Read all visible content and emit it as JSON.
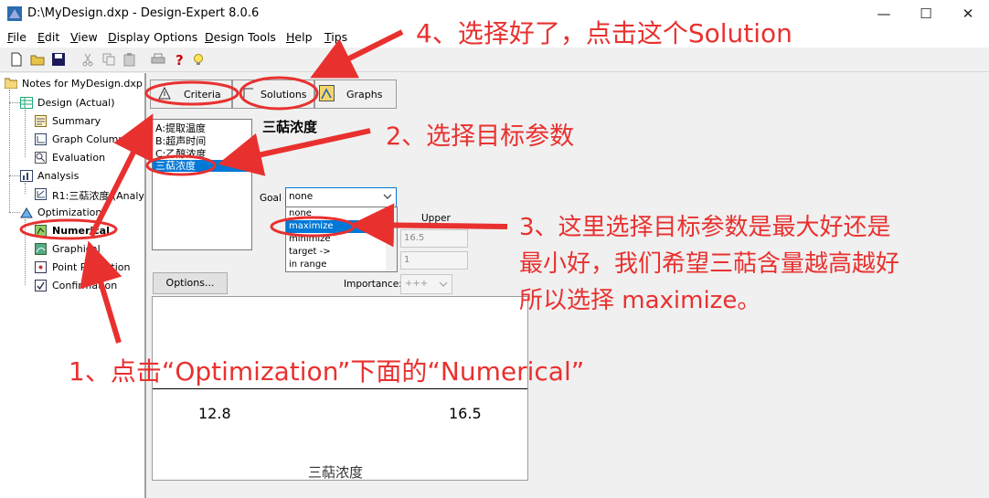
{
  "window": {
    "title": "D:\\MyDesign.dxp - Design-Expert 8.0.6",
    "controls": {
      "minimize": "—",
      "maximize": "☐",
      "close": "✕"
    }
  },
  "menu": [
    "File",
    "Edit",
    "View",
    "Display Options",
    "Design Tools",
    "Help",
    "Tips"
  ],
  "tree": {
    "root": "Notes for MyDesign.dxp",
    "design": "Design (Actual)",
    "summary": "Summary",
    "graph_columns": "Graph Columns",
    "evaluation": "Evaluation",
    "analysis": "Analysis",
    "r1": "R1:三萜浓度 (Analy",
    "optimization": "Optimization",
    "numerical": "Numerical",
    "graphical": "Graphical",
    "point_prediction": "Point Prediction",
    "confirmation": "Confirmation"
  },
  "tabs": {
    "criteria": "Criteria",
    "solutions": "Solutions",
    "graphs": "Graphs"
  },
  "responses": [
    "A:提取温度",
    "B:超声时间",
    "C:乙醇浓度",
    "三萜浓度"
  ],
  "selected_response": "三萜浓度",
  "goal": {
    "label": "Goal",
    "value": "none",
    "options": [
      "none",
      "maximize",
      "minimize",
      "target ->",
      "in range"
    ],
    "highlighted": "maximize"
  },
  "limits": {
    "upper_label": "Upper",
    "upper_value": "16.5",
    "upper_weight": "1"
  },
  "options_button": "Options...",
  "importance": {
    "label": "Importance:",
    "value": "+++"
  },
  "plot": {
    "lower": "12.8",
    "upper": "16.5",
    "label": "三萜浓度"
  },
  "annotations": {
    "step1": "1、点击“Optimization”下面的“Numerical”",
    "step2": "2、选择目标参数",
    "step3": [
      "3、这里选择目标参数是最大好还是",
      "最小好，我们希望三萜含量越高越好",
      "所以选择 maximize。"
    ],
    "step4": "4、选择好了，点击这个Solution"
  },
  "colors": {
    "annotation": "#e8312f",
    "selection": "#0078d7"
  }
}
